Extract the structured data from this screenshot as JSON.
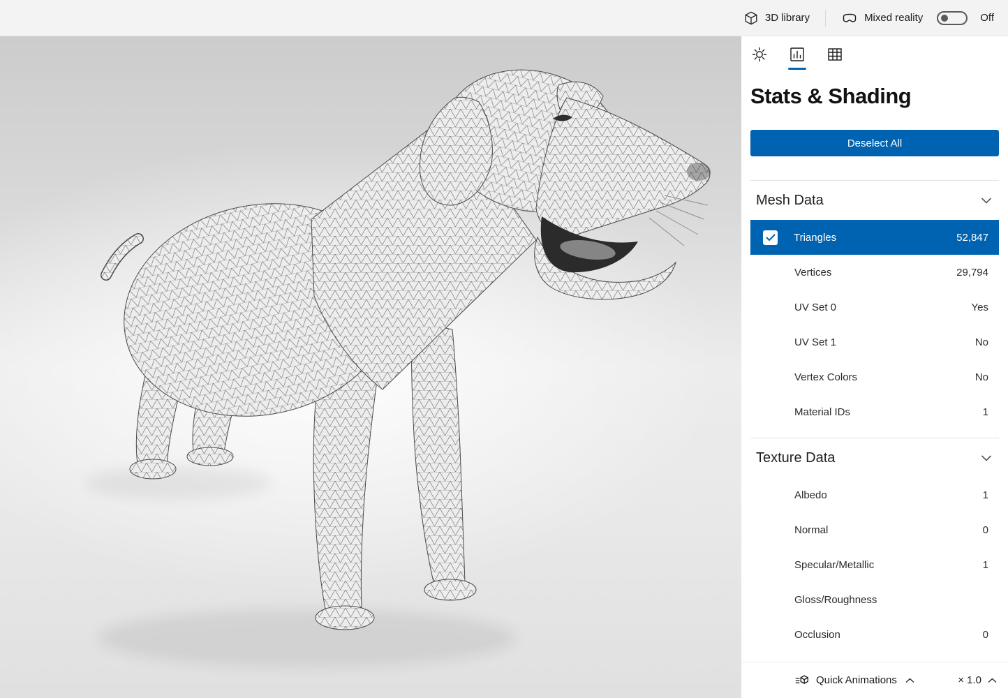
{
  "colors": {
    "accent": "#0063b1"
  },
  "topbar": {
    "library_label": "3D library",
    "mixed_reality_label": "Mixed reality",
    "toggle_state": "Off"
  },
  "panel": {
    "title": "Stats & Shading",
    "deselect_button": "Deselect All",
    "sections": [
      {
        "header": "Mesh Data",
        "rows": [
          {
            "label": "Triangles",
            "value": "52,847",
            "selected": true
          },
          {
            "label": "Vertices",
            "value": "29,794"
          },
          {
            "label": "UV Set 0",
            "value": "Yes"
          },
          {
            "label": "UV Set 1",
            "value": "No"
          },
          {
            "label": "Vertex Colors",
            "value": "No"
          },
          {
            "label": "Material IDs",
            "value": "1"
          }
        ]
      },
      {
        "header": "Texture Data",
        "rows": [
          {
            "label": "Albedo",
            "value": "1"
          },
          {
            "label": "Normal",
            "value": "0"
          },
          {
            "label": "Specular/Metallic",
            "value": "1"
          },
          {
            "label": "Gloss/Roughness",
            "value": ""
          },
          {
            "label": "Occlusion",
            "value": "0"
          }
        ]
      }
    ]
  },
  "bottombar": {
    "quick_animations_label": "Quick Animations",
    "speed_label": "× 1.0"
  }
}
